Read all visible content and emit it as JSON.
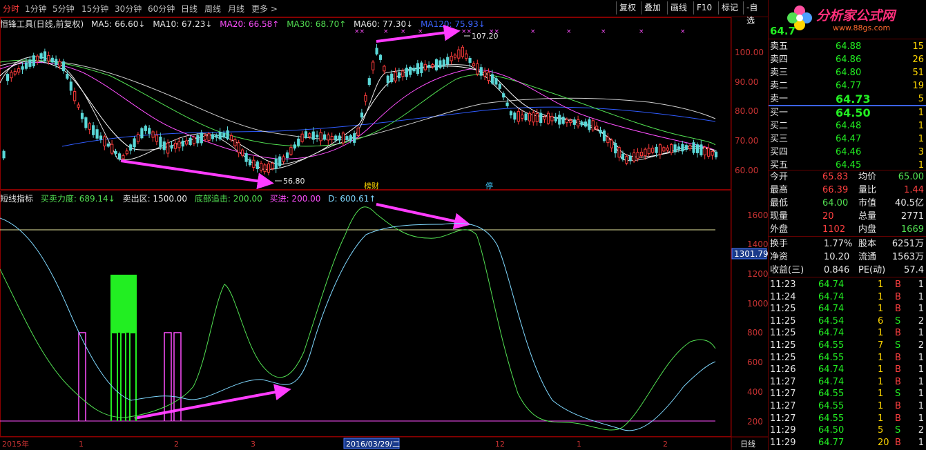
{
  "toolbar": {
    "periods": [
      "分时",
      "1分钟",
      "5分钟",
      "15分钟",
      "30分钟",
      "60分钟",
      "日线",
      "周线",
      "月线",
      "更多 >"
    ],
    "active_period": 0,
    "buttons": [
      "复权",
      "叠加",
      "画线",
      "F10",
      "标记",
      "-自选"
    ]
  },
  "price_panel": {
    "legend": [
      {
        "text": "恒锋工具(日线,前复权)",
        "color": "#e0e0e0"
      },
      {
        "text": "MA5: 66.60↓",
        "color": "#e8e8e8"
      },
      {
        "text": "MA10: 67.23↓",
        "color": "#e8e8e8"
      },
      {
        "text": "MA20: 66.58↑",
        "color": "#ff4fff"
      },
      {
        "text": "MA30: 68.70↑",
        "color": "#52e052"
      },
      {
        "text": "MA60: 77.30↓",
        "color": "#e8e8e8"
      },
      {
        "text": "MA120: 75.93↓",
        "color": "#3c64ff"
      }
    ],
    "y_ticks": [
      "100.00",
      "90.00",
      "80.00",
      "70.00",
      "60.00"
    ],
    "high_label": "107.20",
    "low_label": "56.80",
    "tags": [
      "榜财",
      "停"
    ]
  },
  "indicator_panel": {
    "legend": [
      {
        "text": "短线指标",
        "color": "#e0e0e0"
      },
      {
        "text": "买卖力度: 689.14↓",
        "color": "#52e052"
      },
      {
        "text": "卖出区: 1500.00",
        "color": "#e8e8e8"
      },
      {
        "text": "底部追击: 200.00",
        "color": "#52e052"
      },
      {
        "text": "买进: 200.00",
        "color": "#ff4fff"
      },
      {
        "text": "D: 600.61↑",
        "color": "#7fd8ff"
      }
    ],
    "y_ticks": [
      "1600",
      "1400",
      "1200",
      "1000",
      "800",
      "600",
      "400",
      "200"
    ],
    "cursor_value": "1301.79"
  },
  "x_axis": {
    "labels": [
      "2015年",
      "1",
      "2",
      "3",
      "2016/03/29/二",
      "12",
      "1",
      "2"
    ],
    "period_label": "日线"
  },
  "sidebar": {
    "price": "64.7",
    "logo_text": "分析家公式网",
    "logo_url": "www.88gs.com",
    "asks": [
      {
        "label": "卖五",
        "price": "64.88",
        "vol": "15"
      },
      {
        "label": "卖四",
        "price": "64.86",
        "vol": "26"
      },
      {
        "label": "卖三",
        "price": "64.80",
        "vol": "51"
      },
      {
        "label": "卖二",
        "price": "64.77",
        "vol": "19"
      },
      {
        "label": "卖一",
        "price": "64.73",
        "vol": "5"
      }
    ],
    "bids": [
      {
        "label": "买一",
        "price": "64.50",
        "vol": "1"
      },
      {
        "label": "买二",
        "price": "64.48",
        "vol": "1"
      },
      {
        "label": "买三",
        "price": "64.47",
        "vol": "1"
      },
      {
        "label": "买四",
        "price": "64.46",
        "vol": "3"
      },
      {
        "label": "买五",
        "price": "64.45",
        "vol": "1"
      }
    ],
    "stats": [
      {
        "l1": "今开",
        "v1": "65.83",
        "c1": "#ff4040",
        "l2": "均价",
        "v2": "65.00",
        "c2": "#52e052"
      },
      {
        "l1": "最高",
        "v1": "66.39",
        "c1": "#ff4040",
        "l2": "量比",
        "v2": "1.44",
        "c2": "#ff4040"
      },
      {
        "l1": "最低",
        "v1": "64.00",
        "c1": "#52e052",
        "l2": "市值",
        "v2": "40.5亿",
        "c2": "#e8e8e8"
      },
      {
        "l1": "现量",
        "v1": "20",
        "c1": "#ff4040",
        "l2": "总量",
        "v2": "2771",
        "c2": "#e8e8e8"
      },
      {
        "l1": "外盘",
        "v1": "1102",
        "c1": "#ff4040",
        "l2": "内盘",
        "v2": "1669",
        "c2": "#52e052"
      }
    ],
    "fundamentals": [
      {
        "l1": "换手",
        "v1": "1.77%",
        "l2": "股本",
        "v2": "6251万"
      },
      {
        "l1": "净资",
        "v1": "10.20",
        "l2": "流通",
        "v2": "1563万"
      },
      {
        "l1": "收益(三)",
        "v1": "0.846",
        "l2": "PE(动)",
        "v2": "57.4"
      }
    ],
    "ticks": [
      {
        "t": "11:23",
        "p": "64.74",
        "v": "1",
        "s": "B",
        "n": "1"
      },
      {
        "t": "11:24",
        "p": "64.74",
        "v": "1",
        "s": "B",
        "n": "1"
      },
      {
        "t": "11:25",
        "p": "64.74",
        "v": "1",
        "s": "B",
        "n": "1"
      },
      {
        "t": "11:25",
        "p": "64.54",
        "v": "6",
        "s": "S",
        "n": "2"
      },
      {
        "t": "11:25",
        "p": "64.74",
        "v": "1",
        "s": "B",
        "n": "1"
      },
      {
        "t": "11:25",
        "p": "64.55",
        "v": "7",
        "s": "S",
        "n": "2"
      },
      {
        "t": "11:25",
        "p": "64.55",
        "v": "1",
        "s": "B",
        "n": "1"
      },
      {
        "t": "11:26",
        "p": "64.74",
        "v": "1",
        "s": "B",
        "n": "1"
      },
      {
        "t": "11:27",
        "p": "64.74",
        "v": "1",
        "s": "B",
        "n": "1"
      },
      {
        "t": "11:27",
        "p": "64.55",
        "v": "1",
        "s": "S",
        "n": "1"
      },
      {
        "t": "11:27",
        "p": "64.55",
        "v": "1",
        "s": "B",
        "n": "1"
      },
      {
        "t": "11:27",
        "p": "64.55",
        "v": "1",
        "s": "B",
        "n": "1"
      },
      {
        "t": "11:29",
        "p": "64.50",
        "v": "5",
        "s": "S",
        "n": "2"
      },
      {
        "t": "11:29",
        "p": "64.77",
        "v": "20",
        "s": "B",
        "n": "1"
      }
    ]
  }
}
